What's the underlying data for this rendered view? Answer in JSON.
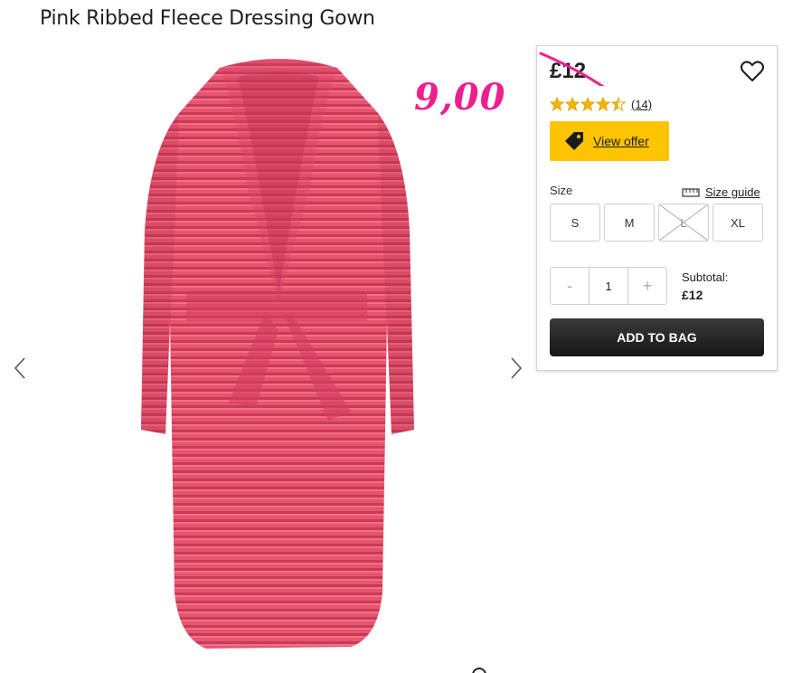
{
  "product": {
    "title": "Pink Ribbed Fleece Dressing Gown"
  },
  "annotation": {
    "new_price": "9,00"
  },
  "panel": {
    "old_price": "£12",
    "rating": {
      "stars": 4.5,
      "max": 5,
      "review_count": "(14)"
    },
    "offer_label": "View offer",
    "size_label": "Size",
    "size_guide_label": "Size guide",
    "sizes": [
      {
        "label": "S",
        "available": true
      },
      {
        "label": "M",
        "available": true
      },
      {
        "label": "L",
        "available": false
      },
      {
        "label": "XL",
        "available": true
      }
    ],
    "quantity": {
      "minus": "-",
      "value": "1",
      "plus": "+"
    },
    "subtotal_label": "Subtotal:",
    "subtotal_value": "£12",
    "add_to_bag_label": "ADD TO BAG"
  },
  "colors": {
    "accent_yellow": "#ffc400",
    "annotation_pink": "#ee1f8c",
    "gown": "#e7546e"
  },
  "icons": [
    "chevron-left-icon",
    "chevron-right-icon",
    "heart-icon",
    "star-icon",
    "price-tag-icon",
    "ruler-icon"
  ]
}
